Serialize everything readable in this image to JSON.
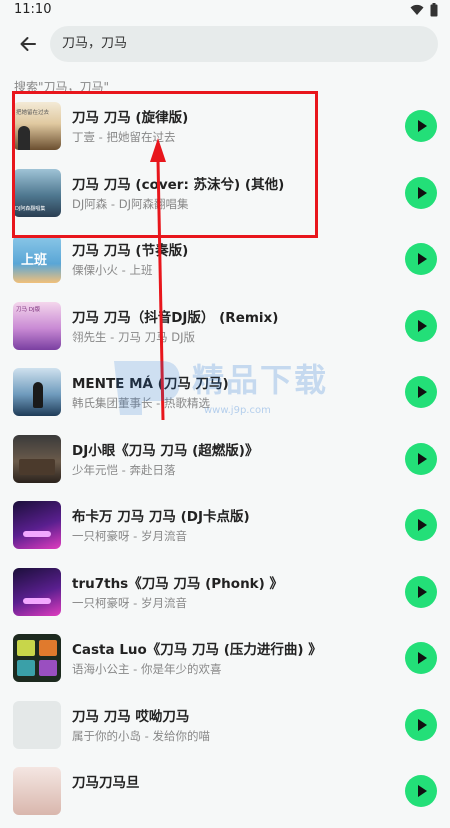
{
  "status_bar": {
    "time": "11:10"
  },
  "search": {
    "query": "刀马，刀马"
  },
  "hint": "搜索\"刀马，刀马\"",
  "results": [
    {
      "title": "刀马 刀马 (旋律版)",
      "subtitle": "丁壹 - 把她留在过去",
      "cover_text": "把她留在过去"
    },
    {
      "title": "刀马 刀马 (cover: 苏沫兮) (其他)",
      "subtitle": "DJ阿森 - DJ阿森翻唱集",
      "cover_text": "DJ阿森翻唱集"
    },
    {
      "title": "刀马 刀马 (节奏版)",
      "subtitle": "傈傈小火 - 上班",
      "cover_text": "上班"
    },
    {
      "title": "刀马 刀马（抖音DJ版） (Remix)",
      "subtitle": "翎先生 - 刀马 刀马 DJ版",
      "cover_text": "刀马 DJ版"
    },
    {
      "title": "MENTE MÁ (刀马 刀马)",
      "subtitle": "韩氏集团董事长 - 热歌精选",
      "cover_text": ""
    },
    {
      "title": "DJ小眼《刀马 刀马 (超燃版)》",
      "subtitle": "少年元恺 - 奔赴日落",
      "cover_text": ""
    },
    {
      "title": "布卡万 刀马 刀马 (DJ卡点版)",
      "subtitle": "一只柯豪呀 - 岁月流音",
      "cover_text": ""
    },
    {
      "title": "tru7ths《刀马 刀马 (Phonk) 》",
      "subtitle": "一只柯豪呀 - 岁月流音",
      "cover_text": ""
    },
    {
      "title": "Casta Luo《刀马 刀马 (压力进行曲) 》",
      "subtitle": "语海小公主 - 你是年少的欢喜",
      "cover_text": ""
    },
    {
      "title": "刀马 刀马 哎呦刀马",
      "subtitle": "属于你的小岛 - 发给你的喵",
      "cover_text": ""
    },
    {
      "title": "刀马刀马旦",
      "subtitle": "",
      "cover_text": ""
    }
  ],
  "watermark": {
    "text": "精品下载",
    "url": "www.j9p.com"
  },
  "colors": {
    "accent": "#23df78",
    "highlight": "#e8161c"
  }
}
